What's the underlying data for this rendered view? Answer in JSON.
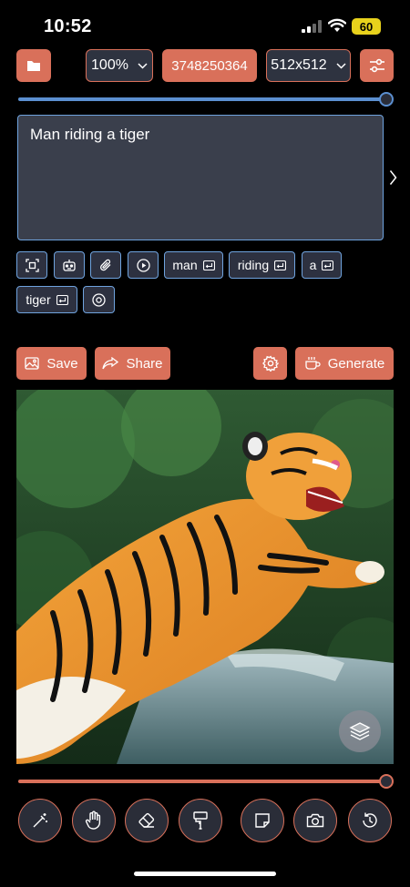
{
  "status_bar": {
    "time": "10:52",
    "battery": "60"
  },
  "toolbar": {
    "zoom": "100%",
    "seed": "3748250364",
    "size": "512x512"
  },
  "prompt": {
    "text": "Man riding a tiger"
  },
  "tokens": [
    "man",
    "riding",
    "a",
    "tiger"
  ],
  "actions": {
    "save": "Save",
    "share": "Share",
    "generate": "Generate"
  },
  "sliders": {
    "top_level": 1.0,
    "bottom_level": 1.0
  },
  "colors": {
    "accent": "#d9705a",
    "panel": "#3a3f4c",
    "border_blue": "#6fa3de",
    "slider_blue": "#5b8fd0"
  },
  "tools": [
    "magic-wand-icon",
    "hand-icon",
    "eraser-icon",
    "paint-roller-icon",
    "sticky-note-icon",
    "camera-icon",
    "history-icon"
  ]
}
